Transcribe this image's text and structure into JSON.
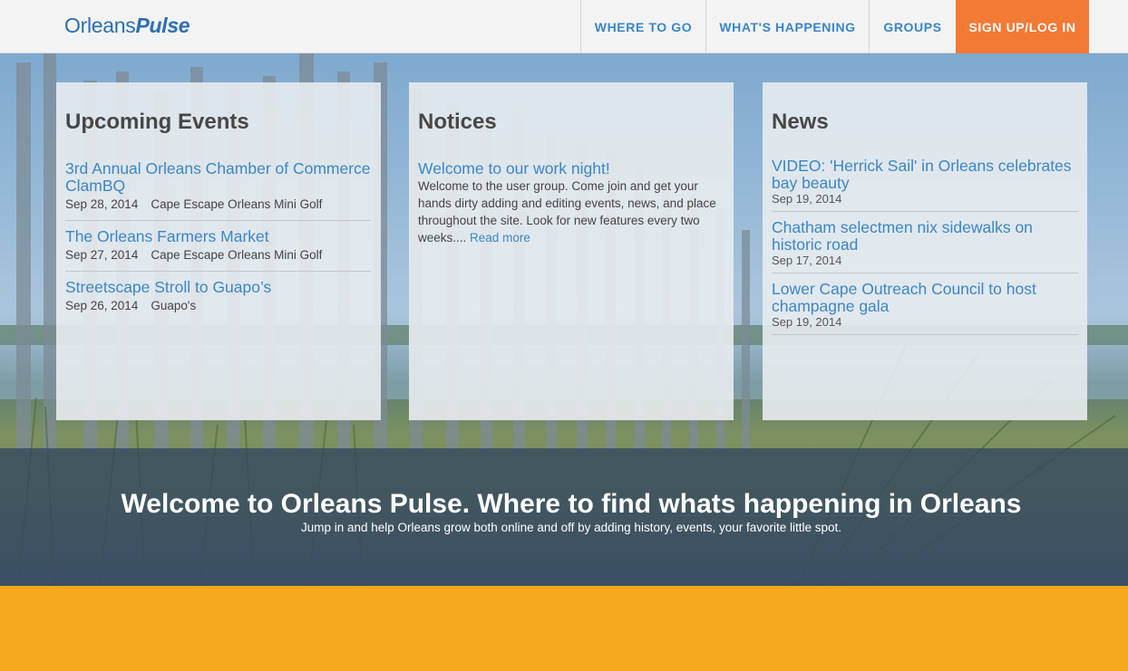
{
  "brand": {
    "name_part1": "Orleans",
    "name_part2": "Pulse"
  },
  "nav": {
    "items": [
      {
        "label": "WHERE TO GO"
      },
      {
        "label": "WHAT'S HAPPENING"
      },
      {
        "label": "GROUPS"
      }
    ],
    "signup_label": "SIGN UP/LOG IN"
  },
  "panels": {
    "events": {
      "heading": "Upcoming Events",
      "items": [
        {
          "title": "3rd Annual Orleans Chamber of Commerce ClamBQ",
          "date": "Sep 28, 2014",
          "place": "Cape Escape Orleans Mini Golf"
        },
        {
          "title": "The Orleans Farmers Market",
          "date": "Sep 27, 2014",
          "place": "Cape Escape Orleans Mini Golf"
        },
        {
          "title": "Streetscape Stroll to Guapo’s",
          "date": "Sep 26, 2014",
          "place": "Guapo's"
        }
      ]
    },
    "notices": {
      "heading": "Notices",
      "title": "Welcome to our work night!",
      "body": "Welcome to the user group. Come join and get your hands dirty adding and editing events, news, and place throughout the site. Look for new features every two weeks....",
      "read_more": "Read more"
    },
    "news": {
      "heading": "News",
      "items": [
        {
          "title": "VIDEO: 'Herrick Sail' in Orleans celebrates bay beauty",
          "date": "Sep 19, 2014"
        },
        {
          "title": "Chatham selectmen nix sidewalks on historic road",
          "date": "Sep 17, 2014"
        },
        {
          "title": "Lower Cape Outreach Council to host champagne gala",
          "date": "Sep 19, 2014"
        }
      ]
    }
  },
  "welcome": {
    "headline": "Welcome to Orleans Pulse. Where to find whats happening in Orleans",
    "subline": "Jump in and help Orleans grow both online and off by adding history, events, your favorite little spot."
  },
  "colors": {
    "accent_blue": "#3c86c6",
    "signup_orange": "#f37a35",
    "footer_yellow": "#f5a91c",
    "band_navy": "#344860"
  }
}
